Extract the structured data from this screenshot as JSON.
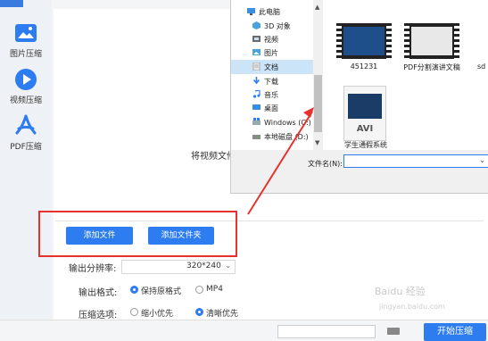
{
  "sidebar": {
    "items": [
      {
        "label": "图片压缩",
        "icon": "image-icon"
      },
      {
        "label": "视频压缩",
        "icon": "video-icon"
      },
      {
        "label": "PDF压缩",
        "icon": "pdf-icon"
      }
    ]
  },
  "main": {
    "caption": "将视频文件",
    "add_file_label": "添加文件",
    "add_folder_label": "添加文件夹"
  },
  "options": {
    "resolution_label": "输出分辨率:",
    "resolution_value": "320*240",
    "format_label": "输出格式:",
    "format_options": [
      "保持原格式",
      "MP4"
    ],
    "format_selected": "保持原格式",
    "compress_label": "压缩选项:",
    "compress_options": [
      "缩小优先",
      "清晰优先"
    ],
    "compress_selected": "清晰优先"
  },
  "bottom": {
    "start_label": "开始压缩"
  },
  "dialog": {
    "nav_items": [
      {
        "label": "此电脑",
        "icon": "computer-icon"
      },
      {
        "label": "3D 对象",
        "icon": "cube-icon"
      },
      {
        "label": "视频",
        "icon": "video-folder-icon"
      },
      {
        "label": "图片",
        "icon": "picture-folder-icon"
      },
      {
        "label": "文档",
        "icon": "document-folder-icon"
      },
      {
        "label": "下载",
        "icon": "download-icon"
      },
      {
        "label": "音乐",
        "icon": "music-icon"
      },
      {
        "label": "桌面",
        "icon": "desktop-folder-icon"
      },
      {
        "label": "Windows (C:)",
        "icon": "windows-drive-icon"
      },
      {
        "label": "本地磁盘 (D:)",
        "icon": "drive-icon"
      }
    ],
    "selected_nav": "文档",
    "files": [
      {
        "name": "451231"
      },
      {
        "name": "PDF分割演讲文稿"
      },
      {
        "name": "sd"
      },
      {
        "name": "学生通假系统"
      }
    ],
    "avi_label": "AVI",
    "filename_label": "文件名(N):",
    "filename_value": ""
  },
  "watermark": {
    "text": "Baidu 经验",
    "sub": "jingyan.baidu.com"
  },
  "colors": {
    "accent": "#2d7cf0",
    "highlight_box": "#e5322d"
  }
}
